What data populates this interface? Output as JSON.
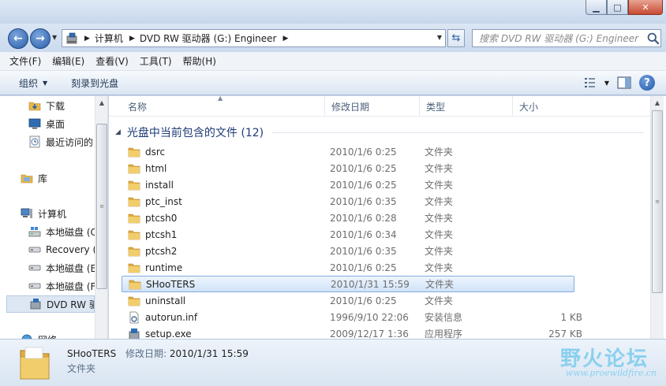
{
  "window": {
    "minimize_label": "▁",
    "maximize_label": "□",
    "close_label": "✕"
  },
  "address_bar": {
    "breadcrumbs": [
      "计算机",
      "DVD RW 驱动器 (G:) Engineer"
    ],
    "search_placeholder": "搜索 DVD RW 驱动器 (G:) Engineer"
  },
  "menu": [
    "文件(F)",
    "编辑(E)",
    "查看(V)",
    "工具(T)",
    "帮助(H)"
  ],
  "toolbar": {
    "organize_label": "组织",
    "burn_label": "刻录到光盘",
    "help_label": "?"
  },
  "sidebar": {
    "items": [
      {
        "label": "下载",
        "icon": "download-folder-icon"
      },
      {
        "label": "桌面",
        "icon": "desktop-icon"
      },
      {
        "label": "最近访问的",
        "icon": "recent-places-icon"
      },
      {
        "label": "库",
        "icon": "library-icon"
      },
      {
        "label": "计算机",
        "icon": "computer-icon"
      },
      {
        "label": "本地磁盘 (C",
        "icon": "system-drive-icon"
      },
      {
        "label": "Recovery (",
        "icon": "hard-drive-icon"
      },
      {
        "label": "本地磁盘 (E",
        "icon": "hard-drive-icon"
      },
      {
        "label": "本地磁盘 (F",
        "icon": "hard-drive-icon"
      },
      {
        "label": "DVD RW 驱",
        "icon": "dvd-drive-icon"
      },
      {
        "label": "网络",
        "icon": "network-icon"
      }
    ]
  },
  "columns": {
    "name": "名称",
    "date": "修改日期",
    "type": "类型",
    "size": "大小"
  },
  "group": {
    "title": "光盘中当前包含的文件 (12)"
  },
  "files": [
    {
      "name": "dsrc",
      "date": "2010/1/6 0:25",
      "type": "文件夹",
      "size": "",
      "icon": "folder"
    },
    {
      "name": "html",
      "date": "2010/1/6 0:25",
      "type": "文件夹",
      "size": "",
      "icon": "folder"
    },
    {
      "name": "install",
      "date": "2010/1/6 0:25",
      "type": "文件夹",
      "size": "",
      "icon": "folder"
    },
    {
      "name": "ptc_inst",
      "date": "2010/1/6 0:35",
      "type": "文件夹",
      "size": "",
      "icon": "folder"
    },
    {
      "name": "ptcsh0",
      "date": "2010/1/6 0:28",
      "type": "文件夹",
      "size": "",
      "icon": "folder"
    },
    {
      "name": "ptcsh1",
      "date": "2010/1/6 0:34",
      "type": "文件夹",
      "size": "",
      "icon": "folder"
    },
    {
      "name": "ptcsh2",
      "date": "2010/1/6 0:35",
      "type": "文件夹",
      "size": "",
      "icon": "folder"
    },
    {
      "name": "runtime",
      "date": "2010/1/6 0:25",
      "type": "文件夹",
      "size": "",
      "icon": "folder"
    },
    {
      "name": "SHooTERS",
      "date": "2010/1/31 15:59",
      "type": "文件夹",
      "size": "",
      "icon": "folder",
      "selected": true
    },
    {
      "name": "uninstall",
      "date": "2010/1/6 0:25",
      "type": "文件夹",
      "size": "",
      "icon": "folder"
    },
    {
      "name": "autorun.inf",
      "date": "1996/9/10 22:06",
      "type": "安装信息",
      "size": "1 KB",
      "icon": "inf"
    },
    {
      "name": "setup.exe",
      "date": "2009/12/17 1:36",
      "type": "应用程序",
      "size": "257 KB",
      "icon": "exe"
    }
  ],
  "details": {
    "name": "SHooTERS",
    "modified_label": "修改日期:",
    "modified_value": "2010/1/31 15:59",
    "type": "文件夹"
  },
  "watermark": {
    "title": "野火论坛",
    "url": "www.proewildfire.cn"
  },
  "colors": {
    "accent": "#1e3b75",
    "selection_border": "#84acdd",
    "folder": "#e8b84a",
    "watermark": "#8ad0ee"
  }
}
